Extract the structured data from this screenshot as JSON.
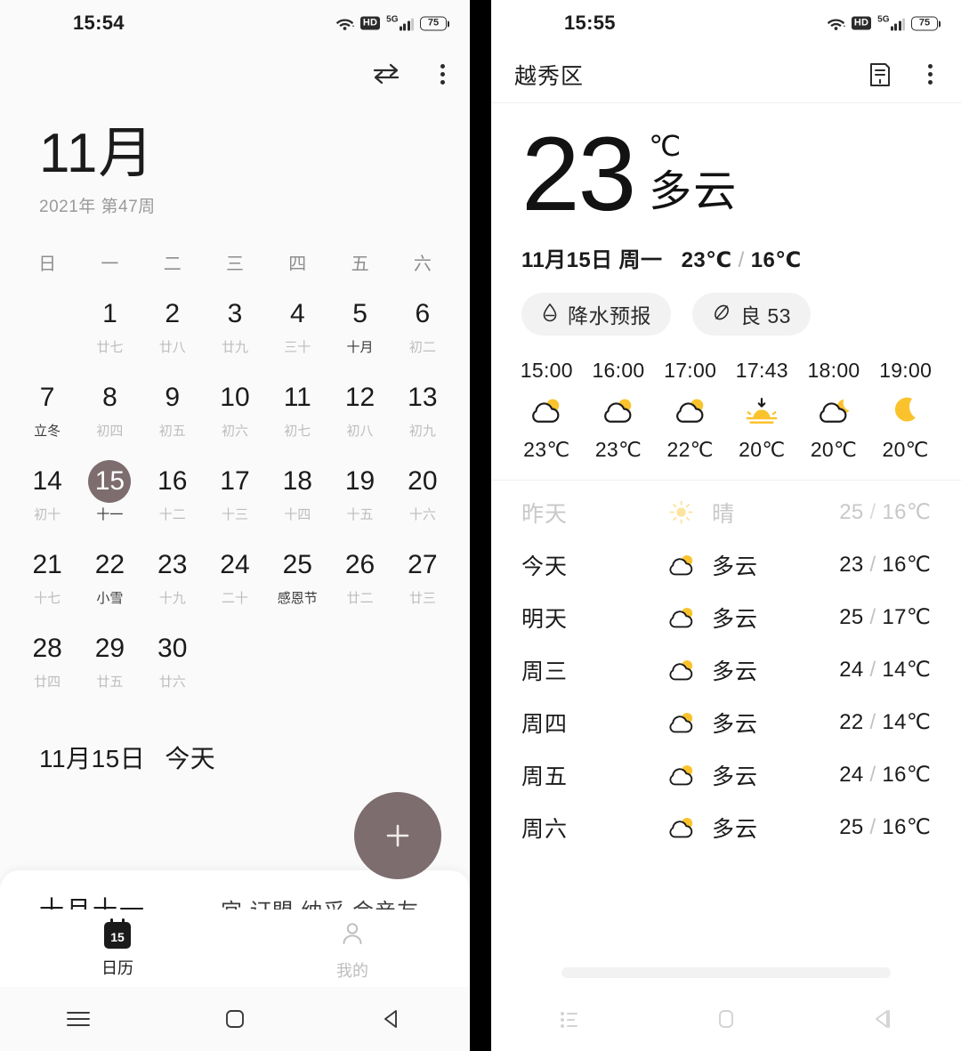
{
  "left_phone": {
    "statusbar": {
      "time": "15:54",
      "battery": "75",
      "hd": "HD",
      "network": "5G",
      "icons": [
        "wifi-icon",
        "hd-icon",
        "signal-icon",
        "battery-icon"
      ]
    },
    "appbar": {
      "swap_icon": "swap-view-icon",
      "menu_icon": "more-vertical-icon"
    },
    "title": {
      "month": "11月",
      "subtitle": "2021年 第47周"
    },
    "weekdays": [
      "日",
      "一",
      "二",
      "三",
      "四",
      "五",
      "六"
    ],
    "calendar": {
      "selected_day": "15",
      "selected_color": "#7d6d6f",
      "weeks": [
        [
          {
            "day": "",
            "lunar": "",
            "empty": true
          },
          {
            "day": "1",
            "lunar": "廿七"
          },
          {
            "day": "2",
            "lunar": "廿八"
          },
          {
            "day": "3",
            "lunar": "廿九"
          },
          {
            "day": "4",
            "lunar": "三十"
          },
          {
            "day": "5",
            "lunar": "十月",
            "hl": true
          },
          {
            "day": "6",
            "lunar": "初二"
          }
        ],
        [
          {
            "day": "7",
            "lunar": "立冬",
            "hl": true
          },
          {
            "day": "8",
            "lunar": "初四"
          },
          {
            "day": "9",
            "lunar": "初五"
          },
          {
            "day": "10",
            "lunar": "初六"
          },
          {
            "day": "11",
            "lunar": "初七"
          },
          {
            "day": "12",
            "lunar": "初八"
          },
          {
            "day": "13",
            "lunar": "初九"
          }
        ],
        [
          {
            "day": "14",
            "lunar": "初十"
          },
          {
            "day": "15",
            "lunar": "十一",
            "today": true,
            "hl": true
          },
          {
            "day": "16",
            "lunar": "十二"
          },
          {
            "day": "17",
            "lunar": "十三"
          },
          {
            "day": "18",
            "lunar": "十四"
          },
          {
            "day": "19",
            "lunar": "十五"
          },
          {
            "day": "20",
            "lunar": "十六"
          }
        ],
        [
          {
            "day": "21",
            "lunar": "十七"
          },
          {
            "day": "22",
            "lunar": "小雪",
            "hl": true
          },
          {
            "day": "23",
            "lunar": "十九"
          },
          {
            "day": "24",
            "lunar": "二十"
          },
          {
            "day": "25",
            "lunar": "感恩节",
            "hl": true
          },
          {
            "day": "26",
            "lunar": "廿二"
          },
          {
            "day": "27",
            "lunar": "廿三"
          }
        ],
        [
          {
            "day": "28",
            "lunar": "廿四"
          },
          {
            "day": "29",
            "lunar": "廿五"
          },
          {
            "day": "30",
            "lunar": "廿六"
          },
          {
            "day": "",
            "lunar": "",
            "empty": true
          },
          {
            "day": "",
            "lunar": "",
            "empty": true
          },
          {
            "day": "",
            "lunar": "",
            "empty": true
          },
          {
            "day": "",
            "lunar": "",
            "empty": true
          }
        ]
      ]
    },
    "today_bar": {
      "date": "11月15日",
      "label": "今天"
    },
    "fab": {
      "icon": "plus-icon",
      "color": "#7d6d6f"
    },
    "day_card": {
      "lunar": "十月十一",
      "yi": "宜 订盟 纳采 会亲友"
    },
    "tabbar": [
      {
        "label": "日历",
        "icon": "calendar-icon",
        "active": true
      },
      {
        "label": "我的",
        "icon": "person-icon",
        "active": false
      }
    ],
    "navbar": [
      "menu-icon",
      "home-icon",
      "back-icon"
    ]
  },
  "right_phone": {
    "statusbar": {
      "time": "15:55",
      "battery": "75",
      "hd": "HD",
      "network": "5G",
      "icons": [
        "wifi-icon",
        "hd-icon",
        "signal-icon",
        "battery-icon"
      ]
    },
    "appbar": {
      "city": "越秀区",
      "list_icon": "city-list-icon",
      "menu_icon": "more-vertical-icon"
    },
    "hero": {
      "temperature": "23",
      "unit": "℃",
      "condition": "多云"
    },
    "dateline": {
      "date": "11月15日",
      "weekday": "周一",
      "high": "23℃",
      "separator": "/",
      "low": "16℃"
    },
    "pills": [
      {
        "label": "降水预报",
        "icon": "raindrop-icon"
      },
      {
        "label": "良 53",
        "icon": "leaf-icon"
      }
    ],
    "hourly": [
      {
        "time": "15:00",
        "icon": "cloudy-day-icon",
        "temp": "23℃"
      },
      {
        "time": "16:00",
        "icon": "cloudy-day-icon",
        "temp": "23℃"
      },
      {
        "time": "17:00",
        "icon": "cloudy-day-icon",
        "temp": "22℃"
      },
      {
        "time": "17:43",
        "icon": "sunset-icon",
        "temp": "20℃"
      },
      {
        "time": "18:00",
        "icon": "cloudy-night-icon",
        "temp": "20℃"
      },
      {
        "time": "19:00",
        "icon": "moon-icon",
        "temp": "20℃"
      }
    ],
    "daily": [
      {
        "name": "昨天",
        "icon": "sunny-icon",
        "condition": "晴",
        "high": "25",
        "low": "16℃",
        "past": true
      },
      {
        "name": "今天",
        "icon": "cloudy-day-icon",
        "condition": "多云",
        "high": "23",
        "low": "16℃",
        "past": false
      },
      {
        "name": "明天",
        "icon": "cloudy-day-icon",
        "condition": "多云",
        "high": "25",
        "low": "17℃",
        "past": false
      },
      {
        "name": "周三",
        "icon": "cloudy-day-icon",
        "condition": "多云",
        "high": "24",
        "low": "14℃",
        "past": false
      },
      {
        "name": "周四",
        "icon": "cloudy-day-icon",
        "condition": "多云",
        "high": "22",
        "low": "14℃",
        "past": false
      },
      {
        "name": "周五",
        "icon": "cloudy-day-icon",
        "condition": "多云",
        "high": "24",
        "low": "16℃",
        "past": false
      },
      {
        "name": "周六",
        "icon": "cloudy-day-icon",
        "condition": "多云",
        "high": "25",
        "low": "16℃",
        "past": false
      }
    ],
    "navbar": [
      "recents-icon",
      "home-icon",
      "back-icon"
    ],
    "accent_yellow": "#fac32e"
  }
}
